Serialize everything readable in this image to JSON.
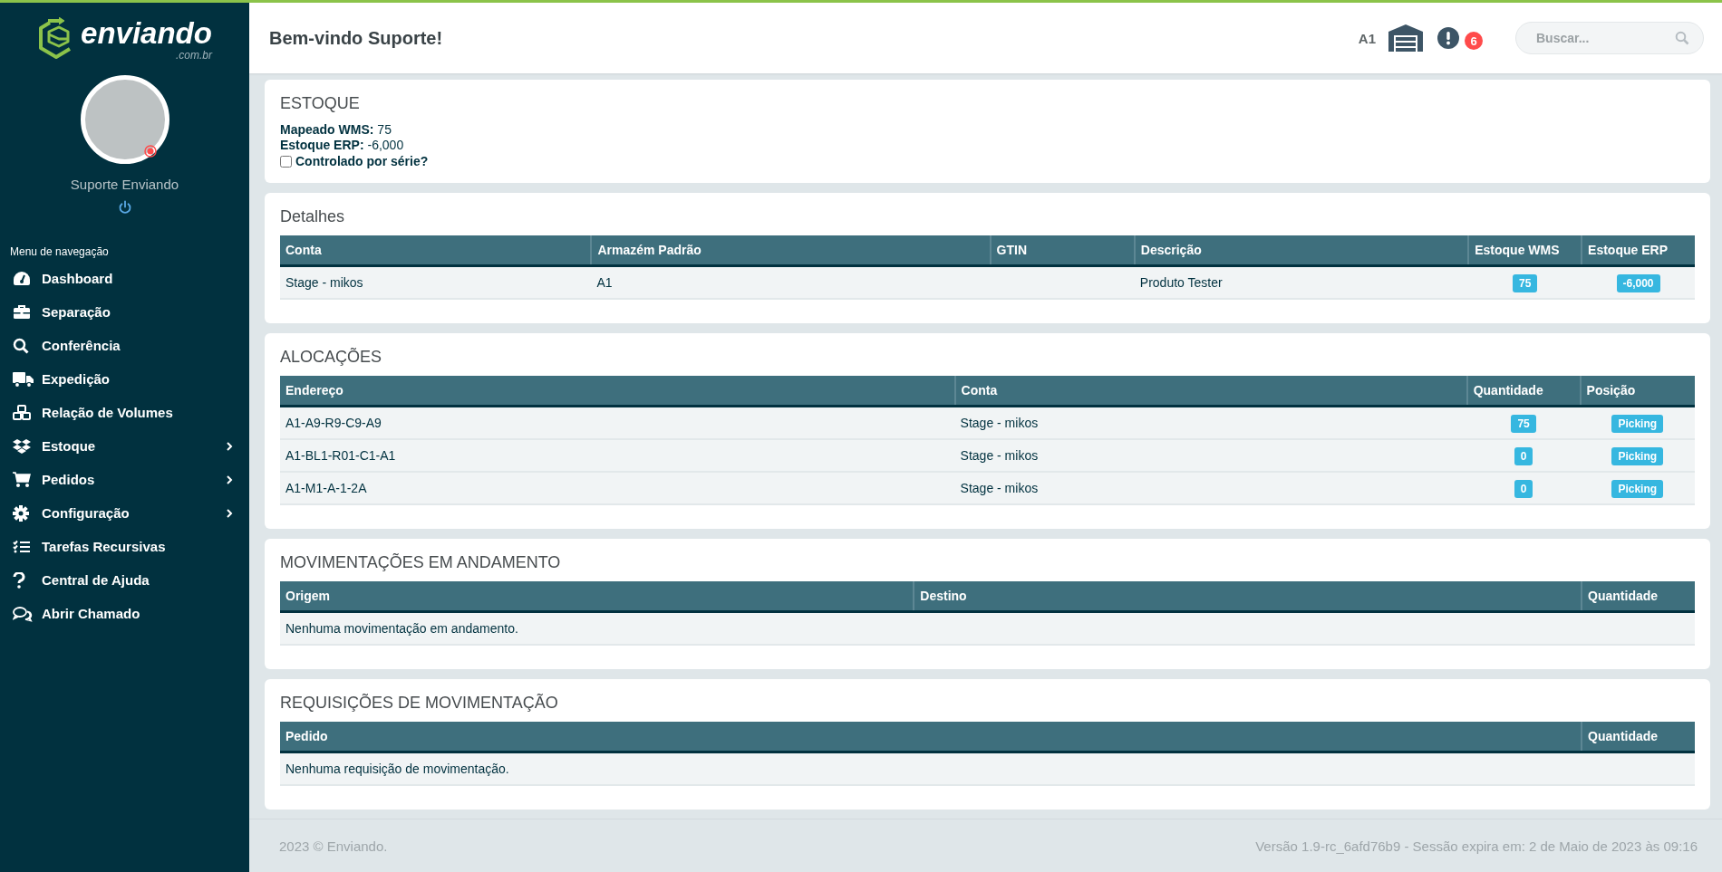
{
  "sidebar": {
    "logo": {
      "name": "enviando",
      "domain": ".com.br"
    },
    "user": {
      "name": "Suporte Enviando"
    },
    "menu_title": "Menu de navegação",
    "items": [
      {
        "label": "Dashboard",
        "expandable": false
      },
      {
        "label": "Separação",
        "expandable": false
      },
      {
        "label": "Conferência",
        "expandable": false
      },
      {
        "label": "Expedição",
        "expandable": false
      },
      {
        "label": "Relação de Volumes",
        "expandable": false
      },
      {
        "label": "Estoque",
        "expandable": true
      },
      {
        "label": "Pedidos",
        "expandable": true
      },
      {
        "label": "Configuração",
        "expandable": true
      },
      {
        "label": "Tarefas Recursivas",
        "expandable": false
      },
      {
        "label": "Central de Ajuda",
        "expandable": false
      },
      {
        "label": "Abrir Chamado",
        "expandable": false
      }
    ]
  },
  "header": {
    "title": "Bem-vindo Suporte!",
    "warehouse": "A1",
    "notification_count": "6",
    "search": {
      "placeholder": "Buscar..."
    }
  },
  "stock": {
    "title": "ESTOQUE",
    "fields": [
      {
        "label": "Mapeado WMS:",
        "value": "75"
      },
      {
        "label": "Estoque ERP:",
        "value": "-6,000"
      }
    ],
    "serial_checkbox": {
      "label": "Controlado por série?",
      "checked": false
    }
  },
  "sections": [
    {
      "title": "Detalhes",
      "columns": [
        "Conta",
        "Armazém Padrão",
        "GTIN",
        "Descrição",
        "Estoque WMS",
        "Estoque ERP"
      ],
      "rows": [
        [
          {
            "kind": "text",
            "text": "Stage - mikos"
          },
          {
            "kind": "text",
            "text": "A1"
          },
          {
            "kind": "empty"
          },
          {
            "kind": "text",
            "text": "Produto Tester"
          },
          {
            "kind": "badge",
            "text": "75"
          },
          {
            "kind": "badge",
            "text": "-6,000"
          }
        ]
      ]
    },
    {
      "title": "ALOCAÇÕES",
      "columns": [
        "Endereço",
        "Conta",
        "Quantidade",
        "Posição"
      ],
      "rows": [
        [
          {
            "kind": "text",
            "text": "A1-A9-R9-C9-A9"
          },
          {
            "kind": "text",
            "text": "Stage - mikos"
          },
          {
            "kind": "badge",
            "text": "75"
          },
          {
            "kind": "badge",
            "text": "Picking"
          }
        ],
        [
          {
            "kind": "text",
            "text": "A1-BL1-R01-C1-A1"
          },
          {
            "kind": "text",
            "text": "Stage - mikos"
          },
          {
            "kind": "badge",
            "text": "0"
          },
          {
            "kind": "badge",
            "text": "Picking"
          }
        ],
        [
          {
            "kind": "text",
            "text": "A1-M1-A-1-2A"
          },
          {
            "kind": "text",
            "text": "Stage - mikos"
          },
          {
            "kind": "badge",
            "text": "0"
          },
          {
            "kind": "badge",
            "text": "Picking"
          }
        ]
      ]
    },
    {
      "title": "MOVIMENTAÇÕES EM ANDAMENTO",
      "columns": [
        "Origem",
        "Destino",
        "Quantidade"
      ],
      "empty_message": "Nenhuma movimentação em andamento."
    },
    {
      "title": "REQUISIÇÕES DE MOVIMENTAÇÃO",
      "columns": [
        "Pedido",
        "Quantidade"
      ],
      "empty_message": "Nenhuma requisição de movimentação."
    }
  ],
  "footer": {
    "copyright": "2023 © Enviando.",
    "version": "Versão 1.9-rc_6afd76b9 - Sessão expira em: 2 de Maio de 2023 às 09:16"
  }
}
